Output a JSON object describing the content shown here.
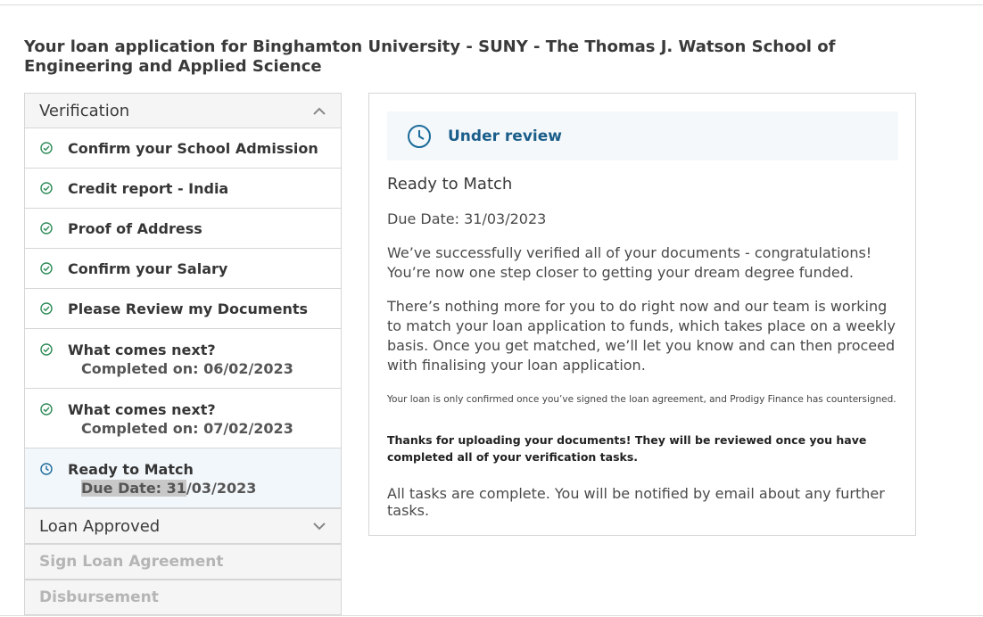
{
  "page": {
    "title": "Your loan application for Binghamton University - SUNY - The Thomas J. Watson School of Engineering and Applied Science"
  },
  "sidebar": {
    "verification": {
      "title": "Verification",
      "steps": [
        {
          "label": "Confirm your School Admission",
          "status": "complete"
        },
        {
          "label": "Credit report - India",
          "status": "complete"
        },
        {
          "label": "Proof of Address",
          "status": "complete"
        },
        {
          "label": "Confirm your Salary",
          "status": "complete"
        },
        {
          "label": "Please Review my Documents",
          "status": "complete"
        },
        {
          "label": "What comes next?",
          "sub": "Completed on: 06/02/2023",
          "status": "complete"
        },
        {
          "label": "What comes next?",
          "sub": "Completed on: 07/02/2023",
          "status": "complete"
        },
        {
          "label": "Ready to Match",
          "sub_highlighted": "Due Date: 31",
          "sub_rest": "/03/2023",
          "status": "pending"
        }
      ]
    },
    "loan_approved": {
      "title": "Loan Approved"
    },
    "sign_loan": {
      "title": "Sign Loan Agreement"
    },
    "disbursement": {
      "title": "Disbursement"
    }
  },
  "panel": {
    "status": "Under review",
    "title": "Ready to Match",
    "due": "Due Date: 31/03/2023",
    "para1": "We’ve successfully verified all of your documents - congratulations! You’re now one step closer to getting your dream degree funded.",
    "para2": "There’s nothing more for you to do right now and our team is working to match your loan application to funds, which takes place on a weekly basis. Once you get matched, we’ll let you know and can then proceed with finalising your loan application.",
    "small_note": "Your loan is only confirmed once you’ve signed the loan agreement, and Prodigy Finance has countersigned.",
    "bold_note": "Thanks for uploading your documents! They will be reviewed once you have completed all of your verification tasks.",
    "final": "All tasks are complete. You will be notified by email about any further tasks."
  },
  "colors": {
    "check_green": "#2e8b57",
    "clock_blue": "#1b6a9a",
    "status_text": "#1b5e8a"
  },
  "icons": {
    "complete": "check-circle-icon",
    "pending": "clock-icon",
    "expanded": "chevron-up-icon",
    "collapsed": "chevron-down-icon"
  }
}
